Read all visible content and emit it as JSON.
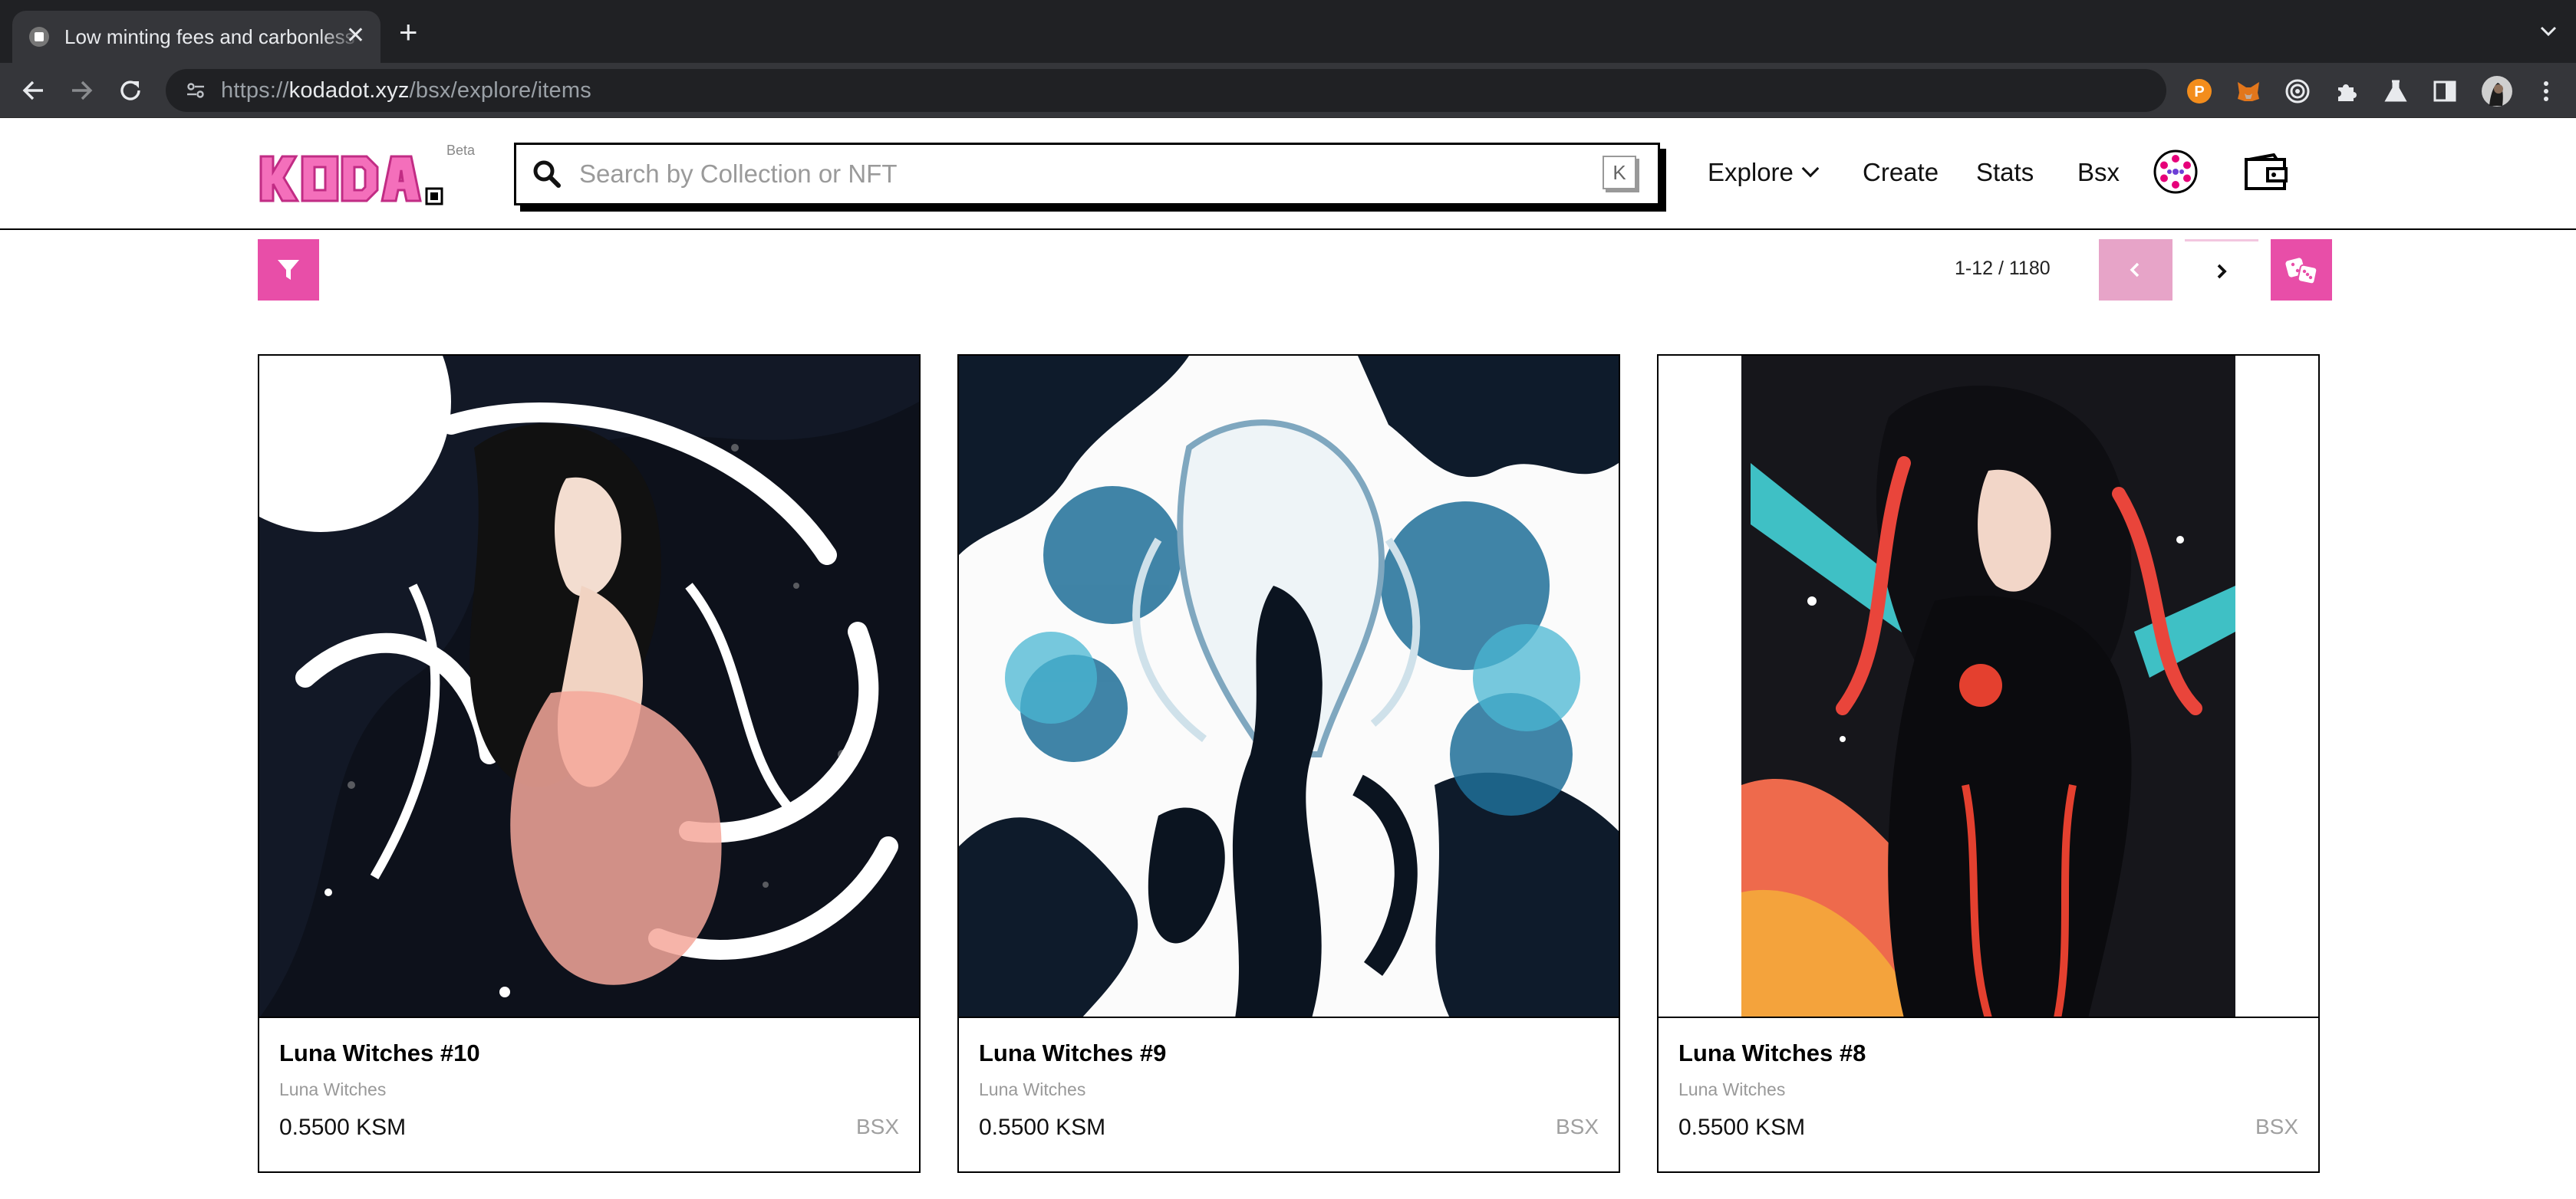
{
  "browser": {
    "tab_title": "Low minting fees and carbonless NFTs",
    "tab_close": "✕",
    "new_tab": "+",
    "url_prefix": "https://",
    "url_host": "kodadot.xyz",
    "url_path": "/bsx/explore/items"
  },
  "header": {
    "beta_label": "Beta",
    "search_placeholder": "Search by Collection or NFT",
    "search_shortcut": "K",
    "nav": {
      "explore": "Explore",
      "create": "Create",
      "stats": "Stats",
      "chain": "Bsx"
    }
  },
  "controls": {
    "pagination": "1-12 / 1180"
  },
  "colors": {
    "accent": "#e84ea8",
    "accent_disabled": "#e7a4c8"
  },
  "icons": {
    "filter": "filter-icon",
    "prev": "chevron-left-icon",
    "next": "chevron-right-icon",
    "random": "dice-icon",
    "search": "search-icon",
    "wallet": "wallet-icon",
    "chain": "polkadot-chain-icon"
  },
  "items": [
    {
      "name": "Luna Witches #10",
      "collection": "Luna Witches",
      "price": "0.5500 KSM",
      "chain": "BSX"
    },
    {
      "name": "Luna Witches #9",
      "collection": "Luna Witches",
      "price": "0.5500 KSM",
      "chain": "BSX"
    },
    {
      "name": "Luna Witches #8",
      "collection": "Luna Witches",
      "price": "0.5500 KSM",
      "chain": "BSX"
    }
  ]
}
